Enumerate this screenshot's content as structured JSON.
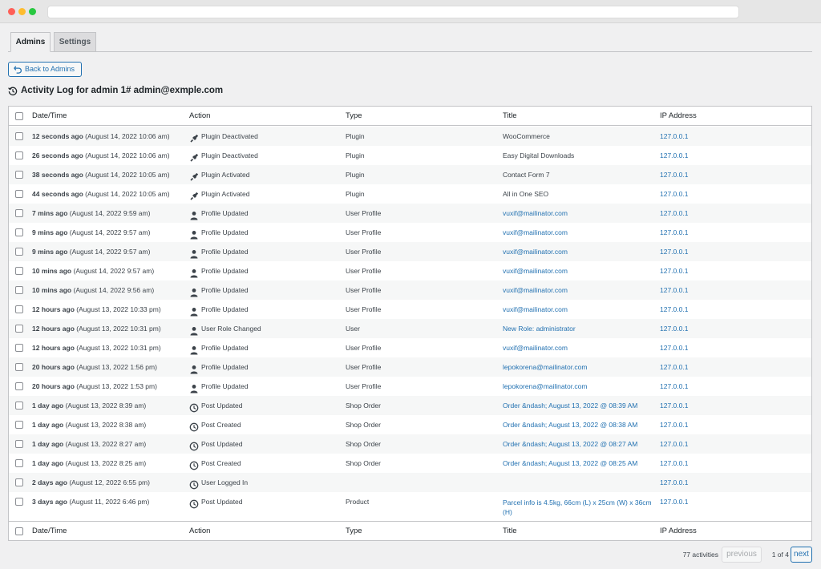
{
  "tabs": [
    {
      "label": "Admins"
    },
    {
      "label": "Settings"
    }
  ],
  "back_button": {
    "label": "Back to Admins",
    "icon": "undo-arrow-icon"
  },
  "heading": {
    "text": "Activity Log for admin 1# admin@exmple.com",
    "icon": "history-icon"
  },
  "table": {
    "columns": [
      "Date/Time",
      "Action",
      "Type",
      "Title",
      "IP Address"
    ],
    "rows": [
      {
        "ago": "12 seconds ago",
        "date": "(August 14, 2022 10:06 am)",
        "action": "Plugin Deactivated",
        "icon": "plugin-icon",
        "type": "Plugin",
        "title": "WooCommerce",
        "title_link": false,
        "ip": "127.0.0.1"
      },
      {
        "ago": "26 seconds ago",
        "date": "(August 14, 2022 10:06 am)",
        "action": "Plugin Deactivated",
        "icon": "plugin-icon",
        "type": "Plugin",
        "title": "Easy Digital Downloads",
        "title_link": false,
        "ip": "127.0.0.1"
      },
      {
        "ago": "38 seconds ago",
        "date": "(August 14, 2022 10:05 am)",
        "action": "Plugin Activated",
        "icon": "plugin-icon",
        "type": "Plugin",
        "title": "Contact Form 7",
        "title_link": false,
        "ip": "127.0.0.1"
      },
      {
        "ago": "44 seconds ago",
        "date": "(August 14, 2022 10:05 am)",
        "action": "Plugin Activated",
        "icon": "plugin-icon",
        "type": "Plugin",
        "title": "All in One SEO",
        "title_link": false,
        "ip": "127.0.0.1"
      },
      {
        "ago": "7 mins ago",
        "date": "(August 14, 2022 9:59 am)",
        "action": "Profile Updated",
        "icon": "user-icon",
        "type": "User Profile",
        "title": "vuxif@mailinator.com",
        "title_link": true,
        "ip": "127.0.0.1"
      },
      {
        "ago": "9 mins ago",
        "date": "(August 14, 2022 9:57 am)",
        "action": "Profile Updated",
        "icon": "user-icon",
        "type": "User Profile",
        "title": "vuxif@mailinator.com",
        "title_link": true,
        "ip": "127.0.0.1"
      },
      {
        "ago": "9 mins ago",
        "date": "(August 14, 2022 9:57 am)",
        "action": "Profile Updated",
        "icon": "user-icon",
        "type": "User Profile",
        "title": "vuxif@mailinator.com",
        "title_link": true,
        "ip": "127.0.0.1"
      },
      {
        "ago": "10 mins ago",
        "date": "(August 14, 2022 9:57 am)",
        "action": "Profile Updated",
        "icon": "user-icon",
        "type": "User Profile",
        "title": "vuxif@mailinator.com",
        "title_link": true,
        "ip": "127.0.0.1"
      },
      {
        "ago": "10 mins ago",
        "date": "(August 14, 2022 9:56 am)",
        "action": "Profile Updated",
        "icon": "user-icon",
        "type": "User Profile",
        "title": "vuxif@mailinator.com",
        "title_link": true,
        "ip": "127.0.0.1"
      },
      {
        "ago": "12 hours ago",
        "date": "(August 13, 2022 10:33 pm)",
        "action": "Profile Updated",
        "icon": "user-icon",
        "type": "User Profile",
        "title": "vuxif@mailinator.com",
        "title_link": true,
        "ip": "127.0.0.1"
      },
      {
        "ago": "12 hours ago",
        "date": "(August 13, 2022 10:31 pm)",
        "action": "User Role Changed",
        "icon": "user-icon",
        "type": "User",
        "title": "New Role: administrator",
        "title_link": true,
        "ip": "127.0.0.1"
      },
      {
        "ago": "12 hours ago",
        "date": "(August 13, 2022 10:31 pm)",
        "action": "Profile Updated",
        "icon": "user-icon",
        "type": "User Profile",
        "title": "vuxif@mailinator.com",
        "title_link": true,
        "ip": "127.0.0.1"
      },
      {
        "ago": "20 hours ago",
        "date": "(August 13, 2022 1:56 pm)",
        "action": "Profile Updated",
        "icon": "user-icon",
        "type": "User Profile",
        "title": "lepokorena@mailinator.com",
        "title_link": true,
        "ip": "127.0.0.1"
      },
      {
        "ago": "20 hours ago",
        "date": "(August 13, 2022 1:53 pm)",
        "action": "Profile Updated",
        "icon": "user-icon",
        "type": "User Profile",
        "title": "lepokorena@mailinator.com",
        "title_link": true,
        "ip": "127.0.0.1"
      },
      {
        "ago": "1 day ago",
        "date": "(August 13, 2022 8:39 am)",
        "action": "Post Updated",
        "icon": "clock-icon",
        "type": "Shop Order",
        "title": "Order &ndash; August 13, 2022 @ 08:39 AM",
        "title_link": true,
        "ip": "127.0.0.1"
      },
      {
        "ago": "1 day ago",
        "date": "(August 13, 2022 8:38 am)",
        "action": "Post Created",
        "icon": "clock-icon",
        "type": "Shop Order",
        "title": "Order &ndash; August 13, 2022 @ 08:38 AM",
        "title_link": true,
        "ip": "127.0.0.1"
      },
      {
        "ago": "1 day ago",
        "date": "(August 13, 2022 8:27 am)",
        "action": "Post Updated",
        "icon": "clock-icon",
        "type": "Shop Order",
        "title": "Order &ndash; August 13, 2022 @ 08:27 AM",
        "title_link": true,
        "ip": "127.0.0.1"
      },
      {
        "ago": "1 day ago",
        "date": "(August 13, 2022 8:25 am)",
        "action": "Post Created",
        "icon": "clock-icon",
        "type": "Shop Order",
        "title": "Order &ndash; August 13, 2022 @ 08:25 AM",
        "title_link": true,
        "ip": "127.0.0.1"
      },
      {
        "ago": "2 days ago",
        "date": "(August 12, 2022 6:55 pm)",
        "action": "User Logged In",
        "icon": "clock-icon",
        "type": "",
        "title": "",
        "title_link": false,
        "ip": "127.0.0.1"
      },
      {
        "ago": "3 days ago",
        "date": "(August 11, 2022 6:46 pm)",
        "action": "Post Updated",
        "icon": "clock-icon",
        "type": "Product",
        "title": "Parcel info is 4.5kg, 66cm (L) x 25cm (W) x 36cm (H)",
        "title_link": true,
        "ip": "127.0.0.1"
      }
    ]
  },
  "pagination": {
    "count": "77 activities",
    "previous": "previous",
    "page_info": "1 of 4",
    "next": "next"
  },
  "colors": {
    "link": "#2271b1",
    "text": "#3c434a",
    "background": "#f0f0f1"
  }
}
